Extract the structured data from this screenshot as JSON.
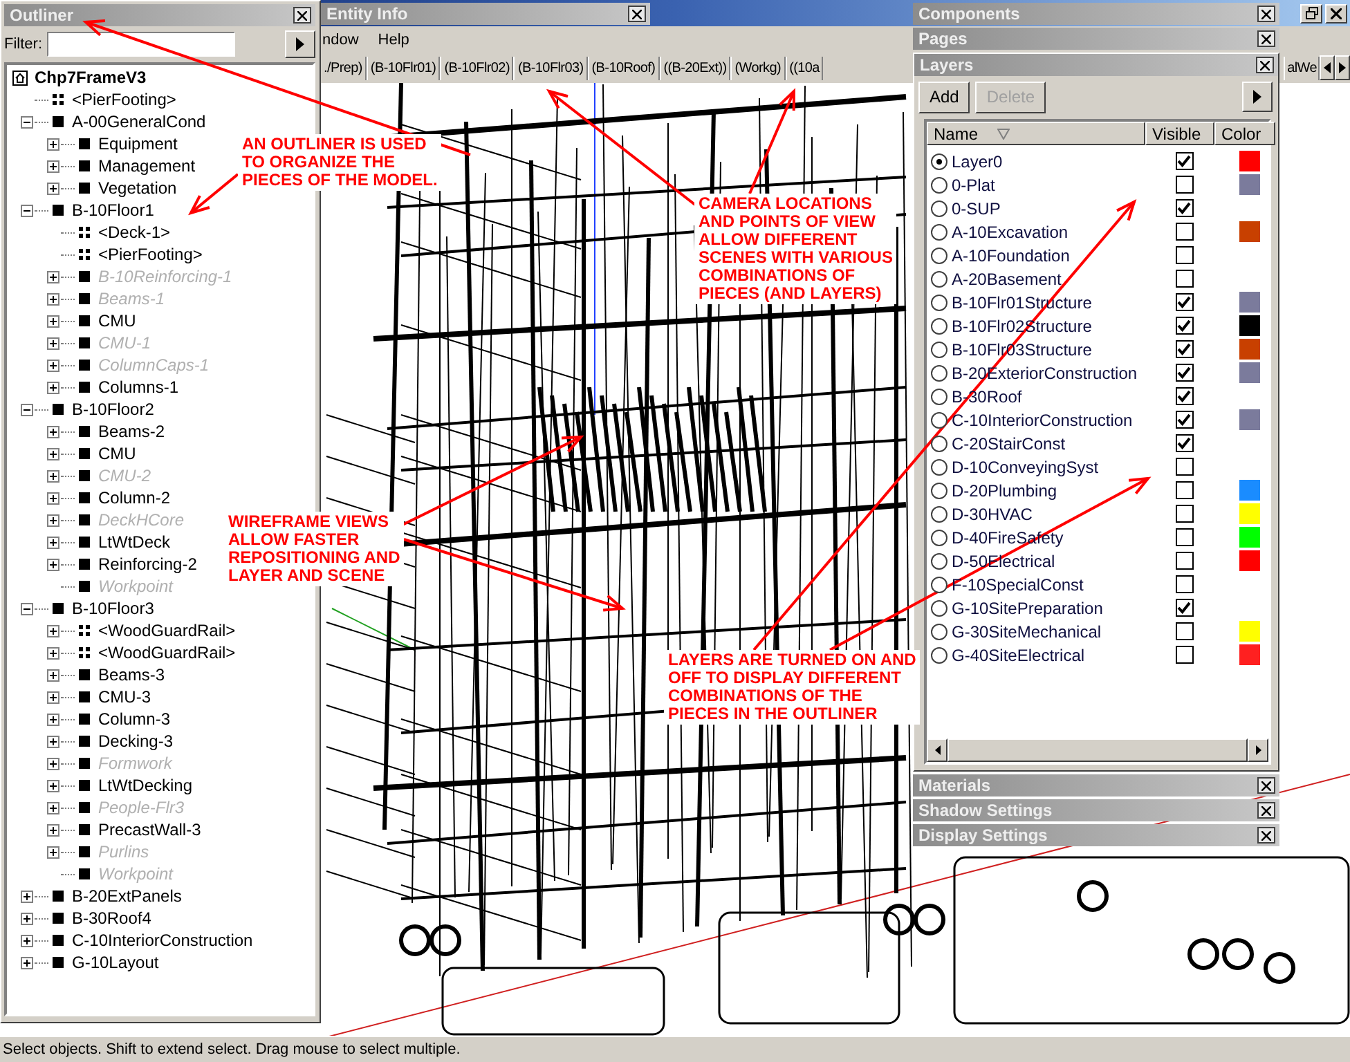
{
  "menu": [
    "ndow",
    "Help"
  ],
  "scene_tabs": {
    "items": [
      "./Prep)",
      "(B-10Flr01)",
      "(B-10Flr02)",
      "(B-10Flr03)",
      "(B-10Roof)",
      "((B-20Ext))",
      "(Workg)",
      "((10a"
    ],
    "overflow_tab": "alWe"
  },
  "entity_info": {
    "title": "Entity Info"
  },
  "outliner": {
    "title": "Outliner",
    "filter_label": "Filter:",
    "root": {
      "label": "Chp7FrameV3",
      "children": [
        {
          "label": "<PierFooting>",
          "kind": "component",
          "hidden": false
        },
        {
          "label": "A-00GeneralCond",
          "kind": "group",
          "expanded": true,
          "hidden": false,
          "children": [
            {
              "label": "Equipment",
              "kind": "group",
              "expanded": false,
              "hidden": false
            },
            {
              "label": "Management",
              "kind": "group",
              "expanded": false,
              "hidden": false
            },
            {
              "label": "Vegetation",
              "kind": "group",
              "expanded": false,
              "hidden": false
            }
          ]
        },
        {
          "label": "B-10Floor1",
          "kind": "group",
          "expanded": true,
          "hidden": false,
          "children": [
            {
              "label": "<Deck-1>",
              "kind": "component",
              "hidden": false
            },
            {
              "label": "<PierFooting>",
              "kind": "component",
              "hidden": false
            },
            {
              "label": "B-10Reinforcing-1",
              "kind": "group",
              "expanded": false,
              "hidden": true
            },
            {
              "label": "Beams-1",
              "kind": "group",
              "expanded": false,
              "hidden": true
            },
            {
              "label": "CMU",
              "kind": "group",
              "expanded": false,
              "hidden": false
            },
            {
              "label": "CMU-1",
              "kind": "group",
              "expanded": false,
              "hidden": true
            },
            {
              "label": "ColumnCaps-1",
              "kind": "group",
              "expanded": false,
              "hidden": true
            },
            {
              "label": "Columns-1",
              "kind": "group",
              "expanded": false,
              "hidden": false
            }
          ]
        },
        {
          "label": "B-10Floor2",
          "kind": "group",
          "expanded": true,
          "hidden": false,
          "children": [
            {
              "label": "Beams-2",
              "kind": "group",
              "expanded": false,
              "hidden": false
            },
            {
              "label": "CMU",
              "kind": "group",
              "expanded": false,
              "hidden": false
            },
            {
              "label": "CMU-2",
              "kind": "group",
              "expanded": false,
              "hidden": true
            },
            {
              "label": "Column-2",
              "kind": "group",
              "expanded": false,
              "hidden": false
            },
            {
              "label": "DeckHCore",
              "kind": "group",
              "expanded": false,
              "hidden": true
            },
            {
              "label": "LtWtDeck",
              "kind": "group",
              "expanded": false,
              "hidden": false
            },
            {
              "label": "Reinforcing-2",
              "kind": "group",
              "expanded": false,
              "hidden": false
            },
            {
              "label": "Workpoint",
              "kind": "group",
              "hidden": true
            }
          ]
        },
        {
          "label": "B-10Floor3",
          "kind": "group",
          "expanded": true,
          "hidden": false,
          "children": [
            {
              "label": "<WoodGuardRail>",
              "kind": "component",
              "expanded": false,
              "hidden": false
            },
            {
              "label": "<WoodGuardRail>",
              "kind": "component",
              "expanded": false,
              "hidden": false
            },
            {
              "label": "Beams-3",
              "kind": "group",
              "expanded": false,
              "hidden": false
            },
            {
              "label": "CMU-3",
              "kind": "group",
              "expanded": false,
              "hidden": false
            },
            {
              "label": "Column-3",
              "kind": "group",
              "expanded": false,
              "hidden": false
            },
            {
              "label": "Decking-3",
              "kind": "group",
              "expanded": false,
              "hidden": false
            },
            {
              "label": "Formwork",
              "kind": "group",
              "expanded": false,
              "hidden": true
            },
            {
              "label": "LtWtDecking",
              "kind": "group",
              "expanded": false,
              "hidden": false
            },
            {
              "label": "People-Flr3",
              "kind": "group",
              "expanded": false,
              "hidden": true
            },
            {
              "label": "PrecastWall-3",
              "kind": "group",
              "expanded": false,
              "hidden": false
            },
            {
              "label": "Purlins",
              "kind": "group",
              "expanded": false,
              "hidden": true
            },
            {
              "label": "Workpoint",
              "kind": "group",
              "hidden": true
            }
          ]
        },
        {
          "label": "B-20ExtPanels",
          "kind": "group",
          "expanded": false,
          "hidden": false
        },
        {
          "label": "B-30Roof4",
          "kind": "group",
          "expanded": false,
          "hidden": false
        },
        {
          "label": "C-10InteriorConstruction",
          "kind": "group",
          "expanded": false,
          "hidden": false
        },
        {
          "label": "G-10Layout",
          "kind": "group",
          "expanded": false,
          "hidden": false
        }
      ]
    }
  },
  "panels_top": [
    "Components",
    "Pages"
  ],
  "layers": {
    "title": "Layers",
    "buttons": [
      {
        "label": "Add",
        "disabled": false
      },
      {
        "label": "Delete",
        "disabled": true
      }
    ],
    "columns": [
      "Name",
      "Visible",
      "Color"
    ],
    "rows": [
      {
        "name": "Layer0",
        "selected": true,
        "visible": true,
        "color": "#ff0000"
      },
      {
        "name": "0-Plat",
        "selected": false,
        "visible": false,
        "color": "#7b7b9c"
      },
      {
        "name": "0-SUP",
        "selected": false,
        "visible": true
      },
      {
        "name": "A-10Excavation",
        "selected": false,
        "visible": false,
        "color": "#c84000"
      },
      {
        "name": "A-10Foundation",
        "selected": false,
        "visible": false
      },
      {
        "name": "A-20Basement",
        "selected": false,
        "visible": false
      },
      {
        "name": "B-10Flr01Structure",
        "selected": false,
        "visible": true,
        "color": "#7b7b9c"
      },
      {
        "name": "B-10Flr02Structure",
        "selected": false,
        "visible": true,
        "color": "#000000"
      },
      {
        "name": "B-10Flr03Structure",
        "selected": false,
        "visible": true,
        "color": "#c84000"
      },
      {
        "name": "B-20ExteriorConstruction",
        "selected": false,
        "visible": true,
        "color": "#7b7b9c"
      },
      {
        "name": "B-30Roof",
        "selected": false,
        "visible": true
      },
      {
        "name": "C-10InteriorConstruction",
        "selected": false,
        "visible": true,
        "color": "#7b7b9c"
      },
      {
        "name": "C-20StairConst",
        "selected": false,
        "visible": true
      },
      {
        "name": "D-10ConveyingSyst",
        "selected": false,
        "visible": false
      },
      {
        "name": "D-20Plumbing",
        "selected": false,
        "visible": false,
        "color": "#1a8cff"
      },
      {
        "name": "D-30HVAC",
        "selected": false,
        "visible": false,
        "color": "#ffff00"
      },
      {
        "name": "D-40FireSafety",
        "selected": false,
        "visible": false,
        "color": "#00ff00"
      },
      {
        "name": "D-50Electrical",
        "selected": false,
        "visible": false,
        "color": "#ff0000"
      },
      {
        "name": "F-10SpecialConst",
        "selected": false,
        "visible": false
      },
      {
        "name": "G-10SitePreparation",
        "selected": false,
        "visible": true
      },
      {
        "name": "G-30SiteMechanical",
        "selected": false,
        "visible": false,
        "color": "#ffff00"
      },
      {
        "name": "G-40SiteElectrical",
        "selected": false,
        "visible": false,
        "color": "#ff2020"
      }
    ]
  },
  "panels_bottom": [
    "Materials",
    "Shadow Settings",
    "Display Settings"
  ],
  "annotations": [
    {
      "text": "AN OUTLINER IS USED\nTO ORGANIZE THE\nPIECES OF THE MODEL."
    },
    {
      "text": "CAMERA LOCATIONS\nAND POINTS OF VIEW\nALLOW DIFFERENT\nSCENES WITH VARIOUS\nCOMBINATIONS OF\nPIECES (AND LAYERS)"
    },
    {
      "text": "WIREFRAME VIEWS\nALLOW FASTER\nREPOSITIONING AND\nLAYER AND SCENE"
    },
    {
      "text": "LAYERS ARE TURNED ON AND\nOFF TO DISPLAY DIFFERENT\nCOMBINATIONS OF THE\nPIECES IN THE OUTLINER"
    }
  ],
  "status_bar": "Select objects. Shift to extend select. Drag mouse to select multiple."
}
